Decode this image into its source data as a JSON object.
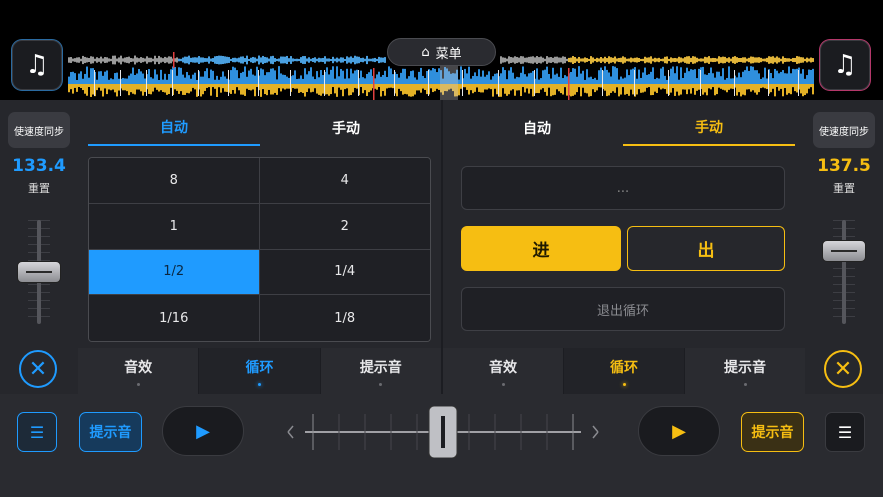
{
  "colors": {
    "left_accent": "#1f9bff",
    "right_accent": "#f6be12"
  },
  "header": {
    "menu_label": "菜单",
    "menu_icon": "home-icon",
    "left_track_icon": "music-note-icon",
    "right_track_icon": "music-note-icon"
  },
  "left": {
    "sync_label": "使速度同步",
    "bpm": "133.4",
    "reset_label": "重置",
    "pitch_position": 0.5
  },
  "right": {
    "sync_label": "使速度同步",
    "bpm": "137.5",
    "reset_label": "重置",
    "pitch_position": 0.3
  },
  "left_deck": {
    "tabs": [
      "自动",
      "手动"
    ],
    "active_tab": 0,
    "loop_sizes": [
      "8",
      "4",
      "1",
      "2",
      "1/2",
      "1/4",
      "1/16",
      "1/8"
    ],
    "selected": "1/2",
    "footer_tabs": [
      "音效",
      "循环",
      "提示音"
    ],
    "active_footer": 1
  },
  "right_deck": {
    "tabs": [
      "自动",
      "手动"
    ],
    "active_tab": 1,
    "loop_field": "...",
    "in_label": "进",
    "out_label": "出",
    "exit_label": "退出循环",
    "footer_tabs": [
      "音效",
      "循环",
      "提示音"
    ],
    "active_footer": 1
  },
  "bottom": {
    "left_cue": "提示音",
    "right_cue": "提示音",
    "crossfader": 0.5
  }
}
